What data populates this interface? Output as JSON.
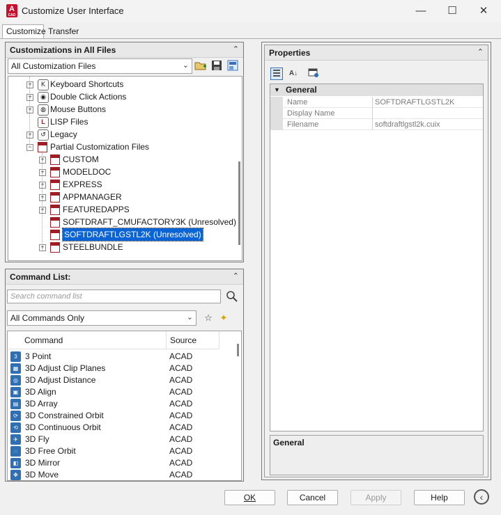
{
  "window": {
    "title": "Customize User Interface",
    "app_icon_letter": "A",
    "app_icon_sub": "CAD"
  },
  "tabs": [
    {
      "label": "Customize"
    },
    {
      "label": "Transfer"
    }
  ],
  "customizations_panel": {
    "title": "Customizations in All Files",
    "filter_value": "All Customization Files",
    "tree": [
      {
        "label": "Keyboard Shortcuts",
        "level": 1,
        "expander": "+",
        "icon": "keyboard-icon"
      },
      {
        "label": "Double Click Actions",
        "level": 1,
        "expander": "+",
        "icon": "double-click-icon"
      },
      {
        "label": "Mouse Buttons",
        "level": 1,
        "expander": "+",
        "icon": "mouse-icon"
      },
      {
        "label": "LISP Files",
        "level": 1,
        "expander": "",
        "icon": "lisp-icon"
      },
      {
        "label": "Legacy",
        "level": 1,
        "expander": "+",
        "icon": "legacy-icon"
      },
      {
        "label": "Partial Customization Files",
        "level": 1,
        "expander": "-",
        "icon": "cuix-icon"
      },
      {
        "label": "CUSTOM",
        "level": 2,
        "expander": "+",
        "icon": "cuix-icon"
      },
      {
        "label": "MODELDOC",
        "level": 2,
        "expander": "+",
        "icon": "cuix-icon"
      },
      {
        "label": "EXPRESS",
        "level": 2,
        "expander": "+",
        "icon": "cuix-icon"
      },
      {
        "label": "APPMANAGER",
        "level": 2,
        "expander": "+",
        "icon": "cuix-icon"
      },
      {
        "label": "FEATUREDAPPS",
        "level": 2,
        "expander": "+",
        "icon": "cuix-icon"
      },
      {
        "label": "SOFTDRAFT_CMUFACTORY3K (Unresolved)",
        "level": 2,
        "expander": "",
        "icon": "cuix-icon"
      },
      {
        "label": "SOFTDRAFTLGSTL2K (Unresolved)",
        "level": 2,
        "expander": "",
        "icon": "cuix-icon",
        "selected": true
      },
      {
        "label": "STEELBUNDLE",
        "level": 2,
        "expander": "+",
        "icon": "cuix-icon"
      }
    ]
  },
  "command_panel": {
    "title": "Command List:",
    "search_placeholder": "Search command list",
    "filter_value": "All Commands Only",
    "columns": [
      "Command",
      "Source"
    ],
    "rows": [
      {
        "command": "3 Point",
        "source": "ACAD",
        "icon": "3"
      },
      {
        "command": "3D Adjust Clip Planes",
        "source": "ACAD",
        "icon": "▦"
      },
      {
        "command": "3D Adjust Distance",
        "source": "ACAD",
        "icon": "◎"
      },
      {
        "command": "3D Align",
        "source": "ACAD",
        "icon": "▣"
      },
      {
        "command": "3D Array",
        "source": "ACAD",
        "icon": "▤"
      },
      {
        "command": "3D Constrained Orbit",
        "source": "ACAD",
        "icon": "⟳"
      },
      {
        "command": "3D Continuous Orbit",
        "source": "ACAD",
        "icon": "⟲"
      },
      {
        "command": "3D Fly",
        "source": "ACAD",
        "icon": "✈"
      },
      {
        "command": "3D Free Orbit",
        "source": "ACAD",
        "icon": "◌"
      },
      {
        "command": "3D Mirror",
        "source": "ACAD",
        "icon": "◧"
      },
      {
        "command": "3D Move",
        "source": "ACAD",
        "icon": "✥"
      }
    ]
  },
  "properties_panel": {
    "title": "Properties",
    "category": "General",
    "rows": [
      {
        "name": "Name",
        "value": "SOFTDRAFTLGSTL2K"
      },
      {
        "name": "Display Name",
        "value": ""
      },
      {
        "name": "Filename",
        "value": "softdraftlgstl2k.cuix"
      }
    ],
    "description_title": "General"
  },
  "buttons": {
    "ok": "OK",
    "cancel": "Cancel",
    "apply": "Apply",
    "help": "Help"
  },
  "colors": {
    "selection": "#0a64d6",
    "cuix_red": "#a01c24",
    "app_red": "#c8102e"
  }
}
